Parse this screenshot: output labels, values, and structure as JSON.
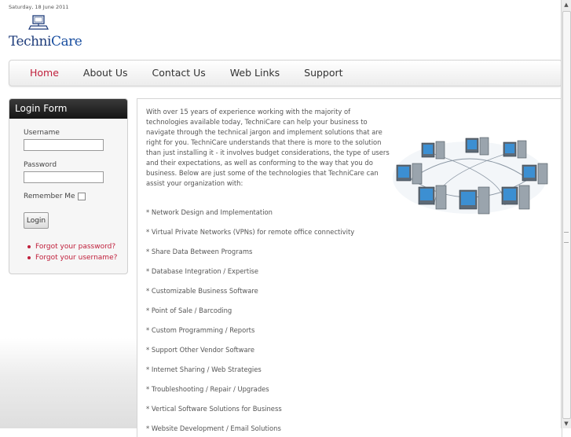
{
  "header": {
    "date": "Saturday, 18 June 2011",
    "logo_text_1": "Techni",
    "logo_text_2": "Care"
  },
  "nav": {
    "items": [
      "Home",
      "About Us",
      "Contact Us",
      "Web Links",
      "Support"
    ],
    "active": "Home"
  },
  "login": {
    "title": "Login Form",
    "username_label": "Username",
    "username_value": "",
    "password_label": "Password",
    "password_value": "",
    "remember_label": "Remember Me",
    "remember_checked": false,
    "button_label": "Login",
    "forgot_password": "Forgot your password?",
    "forgot_username": "Forgot your username?"
  },
  "main": {
    "intro": "With over 15 years of experience working with the majority of technologies available today, TechniCare can help your business to navigate through the technical jargon and implement solutions that are right for you. TechniCare understands that there is more to the solution than just installing it - it involves budget considerations, the type of users and their expectations, as well as conforming to the way that you do business. Below are just some of the technologies that TechniCare can assist your organization with:",
    "services": [
      "* Network Design and Implementation",
      "* Virtual Private Networks (VPNs) for remote office connectivity",
      "* Share Data Between Programs",
      "* Database Integration / Expertise",
      "* Customizable Business Software",
      "* Point of Sale / Barcoding",
      "* Custom Programming / Reports",
      "* Support Other Vendor Software",
      "* Internet Sharing / Web Strategies",
      "* Troubleshooting / Repair / Upgrades",
      "* Vertical Software Solutions for Business",
      "* Website Development / Email Solutions"
    ]
  },
  "colors": {
    "accent": "#c0203c",
    "logo_blue": "#1d3b7a",
    "sidebar_header": "#1e1e1e"
  },
  "icons": {
    "logo": "computer-logo-icon",
    "illustration": "networked-computers-image"
  }
}
